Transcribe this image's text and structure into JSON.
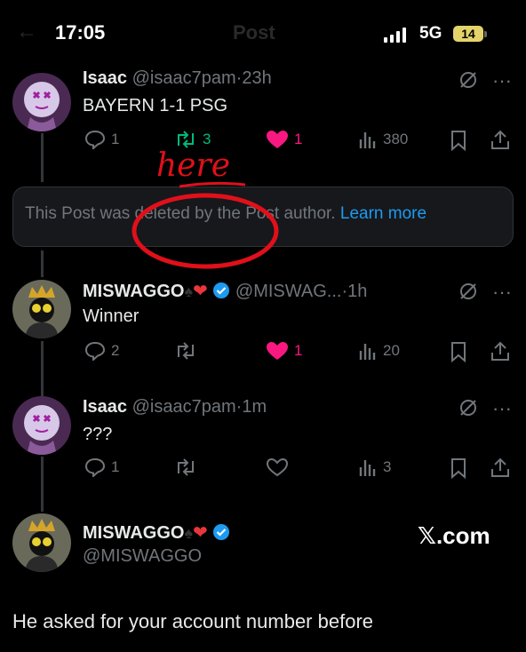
{
  "status_bar": {
    "time": "17:05",
    "network": "5G",
    "battery": "14"
  },
  "header": {
    "title": "Post"
  },
  "posts": [
    {
      "name": "Isaac",
      "handle": "@isaac7pam",
      "time": "23h",
      "text": "BAYERN 1-1 PSG",
      "replies": "1",
      "reposts": "3",
      "likes": "1",
      "views": "380"
    },
    {
      "name": "MISWAGGO",
      "handle": "@MISWAG...",
      "time": "1h",
      "text": "Winner",
      "replies": "2",
      "reposts": "",
      "likes": "1",
      "views": "20"
    },
    {
      "name": "Isaac",
      "handle": "@isaac7pam",
      "time": "1m",
      "text": "???",
      "replies": "1",
      "reposts": "",
      "likes": "",
      "views": "3"
    }
  ],
  "deleted_notice": {
    "text": "This Post was deleted by the Post author.",
    "link": "Learn more"
  },
  "annotation": {
    "text": "here"
  },
  "quote": {
    "name": "MISWAGGO",
    "handle": "@MISWAGGO",
    "watermark": "𝕏.com",
    "text": "He asked for your account number before"
  },
  "colors": {
    "accent": "#1d9bf0",
    "like": "#f91880",
    "repost": "#00ba7c",
    "annotation": "#e0101a"
  }
}
